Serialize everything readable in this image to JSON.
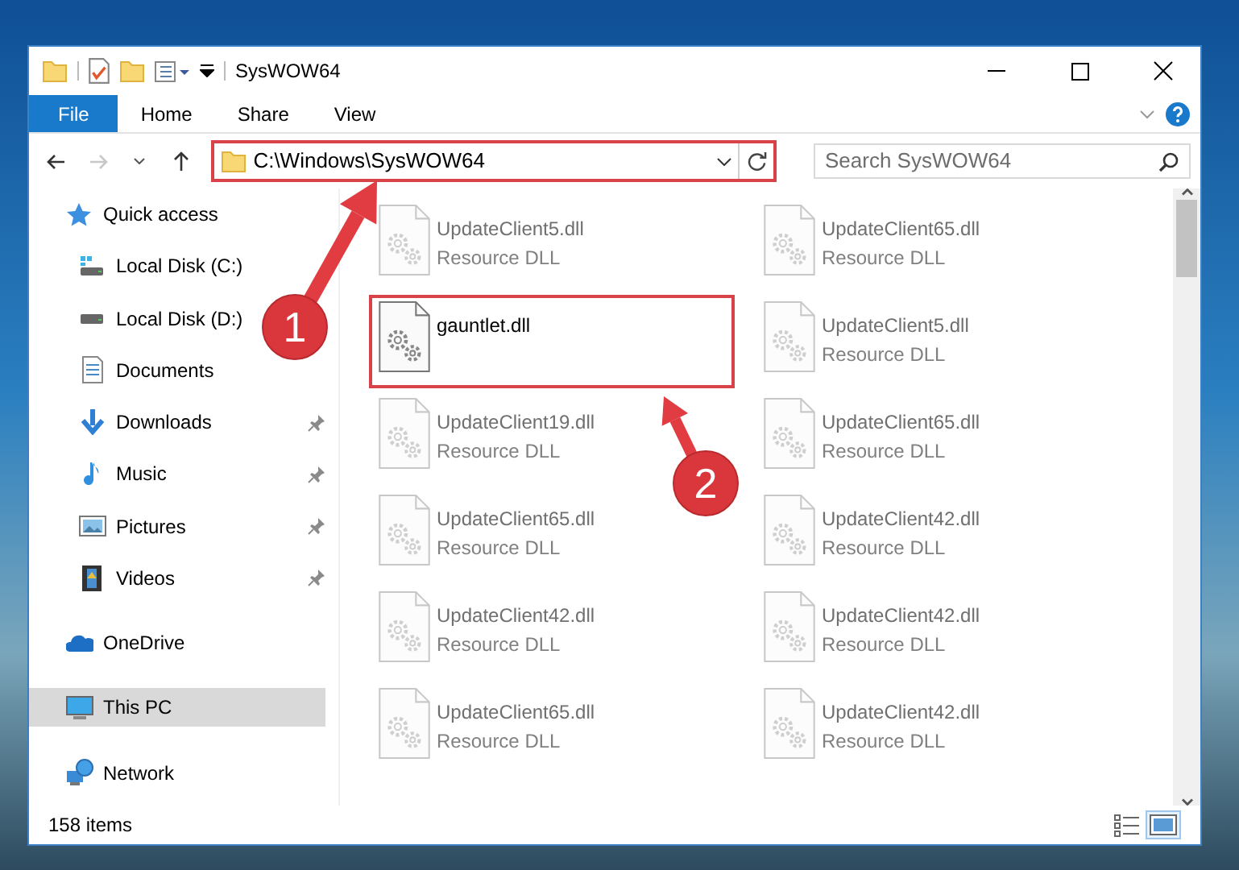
{
  "window": {
    "title": "SysWOW64"
  },
  "ribbon": {
    "tabs": [
      {
        "label": "File",
        "selected": true
      },
      {
        "label": "Home",
        "selected": false
      },
      {
        "label": "Share",
        "selected": false
      },
      {
        "label": "View",
        "selected": false
      }
    ]
  },
  "address_bar": {
    "path": "C:\\Windows\\SysWOW64",
    "highlighted": true,
    "forward_disabled": true
  },
  "search": {
    "placeholder": "Search SysWOW64"
  },
  "sidebar": {
    "items": [
      {
        "label": "Quick access",
        "kind": "quick-access",
        "selected": false,
        "children": [
          {
            "label": "Local Disk (C:)",
            "kind": "drive-c",
            "pinned": false,
            "selected": false
          },
          {
            "label": "Local Disk (D:)",
            "kind": "drive",
            "pinned": false,
            "selected": false
          },
          {
            "label": "Documents",
            "kind": "documents",
            "pinned": false,
            "selected": false
          },
          {
            "label": "Downloads",
            "kind": "downloads",
            "pinned": true,
            "selected": false
          },
          {
            "label": "Music",
            "kind": "music",
            "pinned": true,
            "selected": false
          },
          {
            "label": "Pictures",
            "kind": "pictures",
            "pinned": true,
            "selected": false
          },
          {
            "label": "Videos",
            "kind": "videos",
            "pinned": true,
            "selected": false
          }
        ]
      },
      {
        "label": "OneDrive",
        "kind": "onedrive",
        "selected": false
      },
      {
        "label": "This PC",
        "kind": "this-pc",
        "selected": true
      },
      {
        "label": "Network",
        "kind": "network",
        "selected": false
      }
    ]
  },
  "files": [
    {
      "name": "UpdateClient5.dll",
      "type": "Resource DLL",
      "faded": true,
      "highlighted": false
    },
    {
      "name": "UpdateClient65.dll",
      "type": "Resource DLL",
      "faded": true,
      "highlighted": false
    },
    {
      "name": "gauntlet.dll",
      "faded": false,
      "highlighted": true
    },
    {
      "name": "UpdateClient5.dll",
      "type": "Resource DLL",
      "faded": true,
      "highlighted": false
    },
    {
      "name": "UpdateClient19.dll",
      "type": "Resource DLL",
      "faded": true,
      "highlighted": false
    },
    {
      "name": "UpdateClient65.dll",
      "type": "Resource DLL",
      "faded": true,
      "highlighted": false
    },
    {
      "name": "UpdateClient65.dll",
      "type": "Resource DLL",
      "faded": true,
      "highlighted": false
    },
    {
      "name": "UpdateClient42.dll",
      "type": "Resource DLL",
      "faded": true,
      "highlighted": false
    },
    {
      "name": "UpdateClient42.dll",
      "type": "Resource DLL",
      "faded": true,
      "highlighted": false
    },
    {
      "name": "UpdateClient42.dll",
      "type": "Resource DLL",
      "faded": true,
      "highlighted": false
    },
    {
      "name": "UpdateClient65.dll",
      "type": "Resource DLL",
      "faded": true,
      "highlighted": false
    },
    {
      "name": "UpdateClient42.dll",
      "type": "Resource DLL",
      "faded": true,
      "highlighted": false
    }
  ],
  "status_bar": {
    "text": "158 items",
    "views": [
      {
        "kind": "details",
        "selected": false
      },
      {
        "kind": "large-icons",
        "selected": true
      }
    ]
  },
  "annotations": [
    {
      "label": "1"
    },
    {
      "label": "2"
    }
  ]
}
